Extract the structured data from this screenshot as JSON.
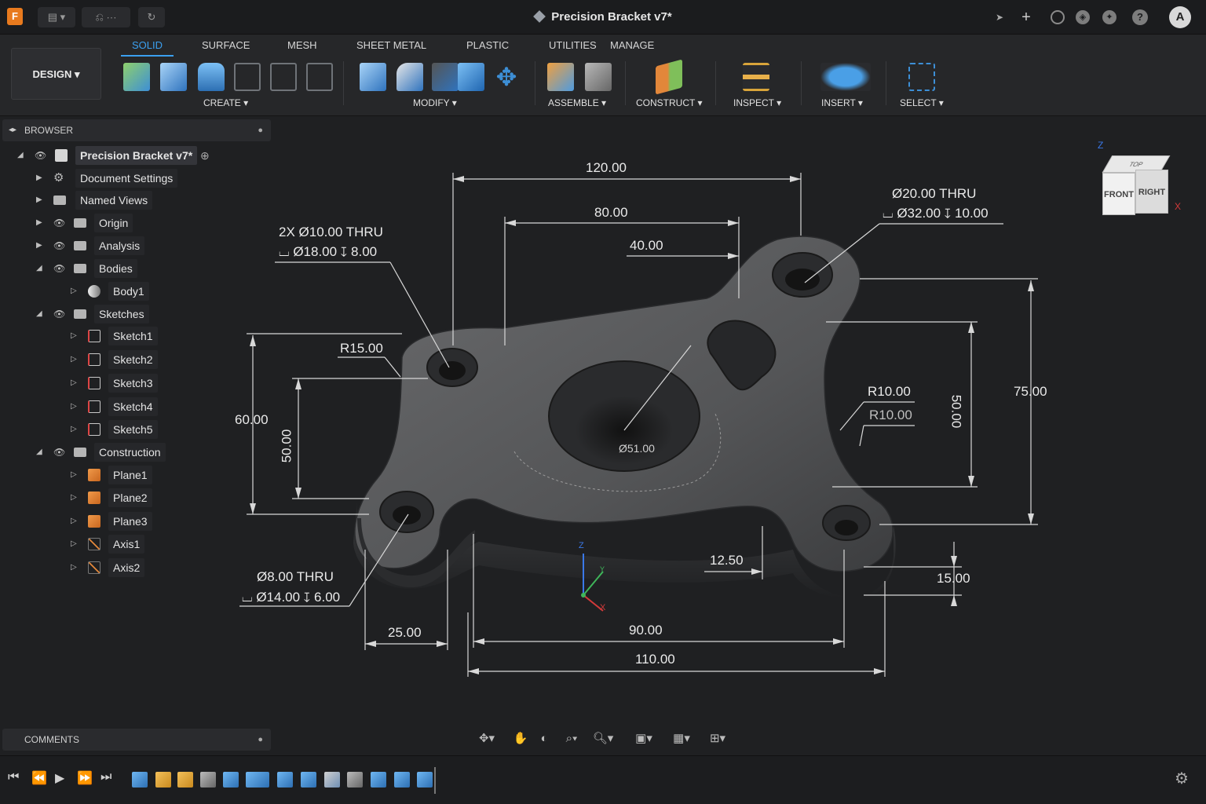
{
  "titlebar": {
    "document_title": "Precision Bracket v7*",
    "avatar_initial": "A"
  },
  "ribbon": {
    "workspace": "DESIGN",
    "tabs": [
      {
        "label": "SOLID",
        "active": true
      },
      {
        "label": "SURFACE"
      },
      {
        "label": "MESH"
      },
      {
        "label": "SHEET METAL"
      },
      {
        "label": "PLASTIC"
      },
      {
        "label": "UTILITIES"
      },
      {
        "label": "MANAGE"
      }
    ],
    "groups": [
      {
        "label": "CREATE"
      },
      {
        "label": "MODIFY"
      },
      {
        "label": "ASSEMBLE"
      },
      {
        "label": "CONSTRUCT"
      },
      {
        "label": "INSPECT"
      },
      {
        "label": "INSERT"
      },
      {
        "label": "SELECT"
      }
    ],
    "colors": {
      "accent": "#3ba0f0",
      "tool_blue": "#3d8fd6",
      "construct_orange": "#e2873a"
    }
  },
  "browser": {
    "header": "BROWSER",
    "root": "Precision Bracket v7*",
    "items": [
      {
        "label": "Document Settings"
      },
      {
        "label": "Named Views"
      },
      {
        "label": "Origin"
      },
      {
        "label": "Analysis"
      },
      {
        "label": "Bodies"
      },
      {
        "label": "Body1"
      },
      {
        "label": "Sketches"
      },
      {
        "label": "Sketch1"
      },
      {
        "label": "Sketch2"
      },
      {
        "label": "Sketch3"
      },
      {
        "label": "Sketch4"
      },
      {
        "label": "Sketch5"
      },
      {
        "label": "Construction"
      },
      {
        "label": "Plane1"
      },
      {
        "label": "Plane2"
      },
      {
        "label": "Plane3"
      },
      {
        "label": "Axis1"
      },
      {
        "label": "Axis2"
      }
    ]
  },
  "comments": {
    "header": "COMMENTS"
  },
  "viewcube": {
    "front": "FRONT",
    "right": "RIGHT",
    "top": "TOP",
    "axis_z": "Z",
    "axis_x": "X"
  },
  "triad": {
    "axis_z": "Z",
    "axis_x": "X",
    "axis_y": "Y"
  },
  "dimensions": {
    "d120": "120.00",
    "d80": "80.00",
    "d40": "40.00",
    "d60": "60.00",
    "d50": "50.00",
    "d75": "75.00",
    "d50_right": "50.00",
    "d25": "25.00",
    "d90": "90.00",
    "d110": "110.00",
    "d12_5": "12.50",
    "d15": "15.00",
    "r15": "R15.00",
    "r10a": "R10.00",
    "r10b": "R10.00",
    "hole_left_1": "2X Ø10.00 THRU",
    "hole_left_2": "⌴ Ø18.00 ↧ 8.00",
    "hole_right_1": "Ø20.00 THRU",
    "hole_right_2": "⌴ Ø32.00 ↧ 10.00",
    "hole_bottom_1": "Ø8.00 THRU",
    "hole_bottom_2": "⌴ Ø14.00 ↧ 6.00",
    "center_bore": "Ø51.00"
  }
}
